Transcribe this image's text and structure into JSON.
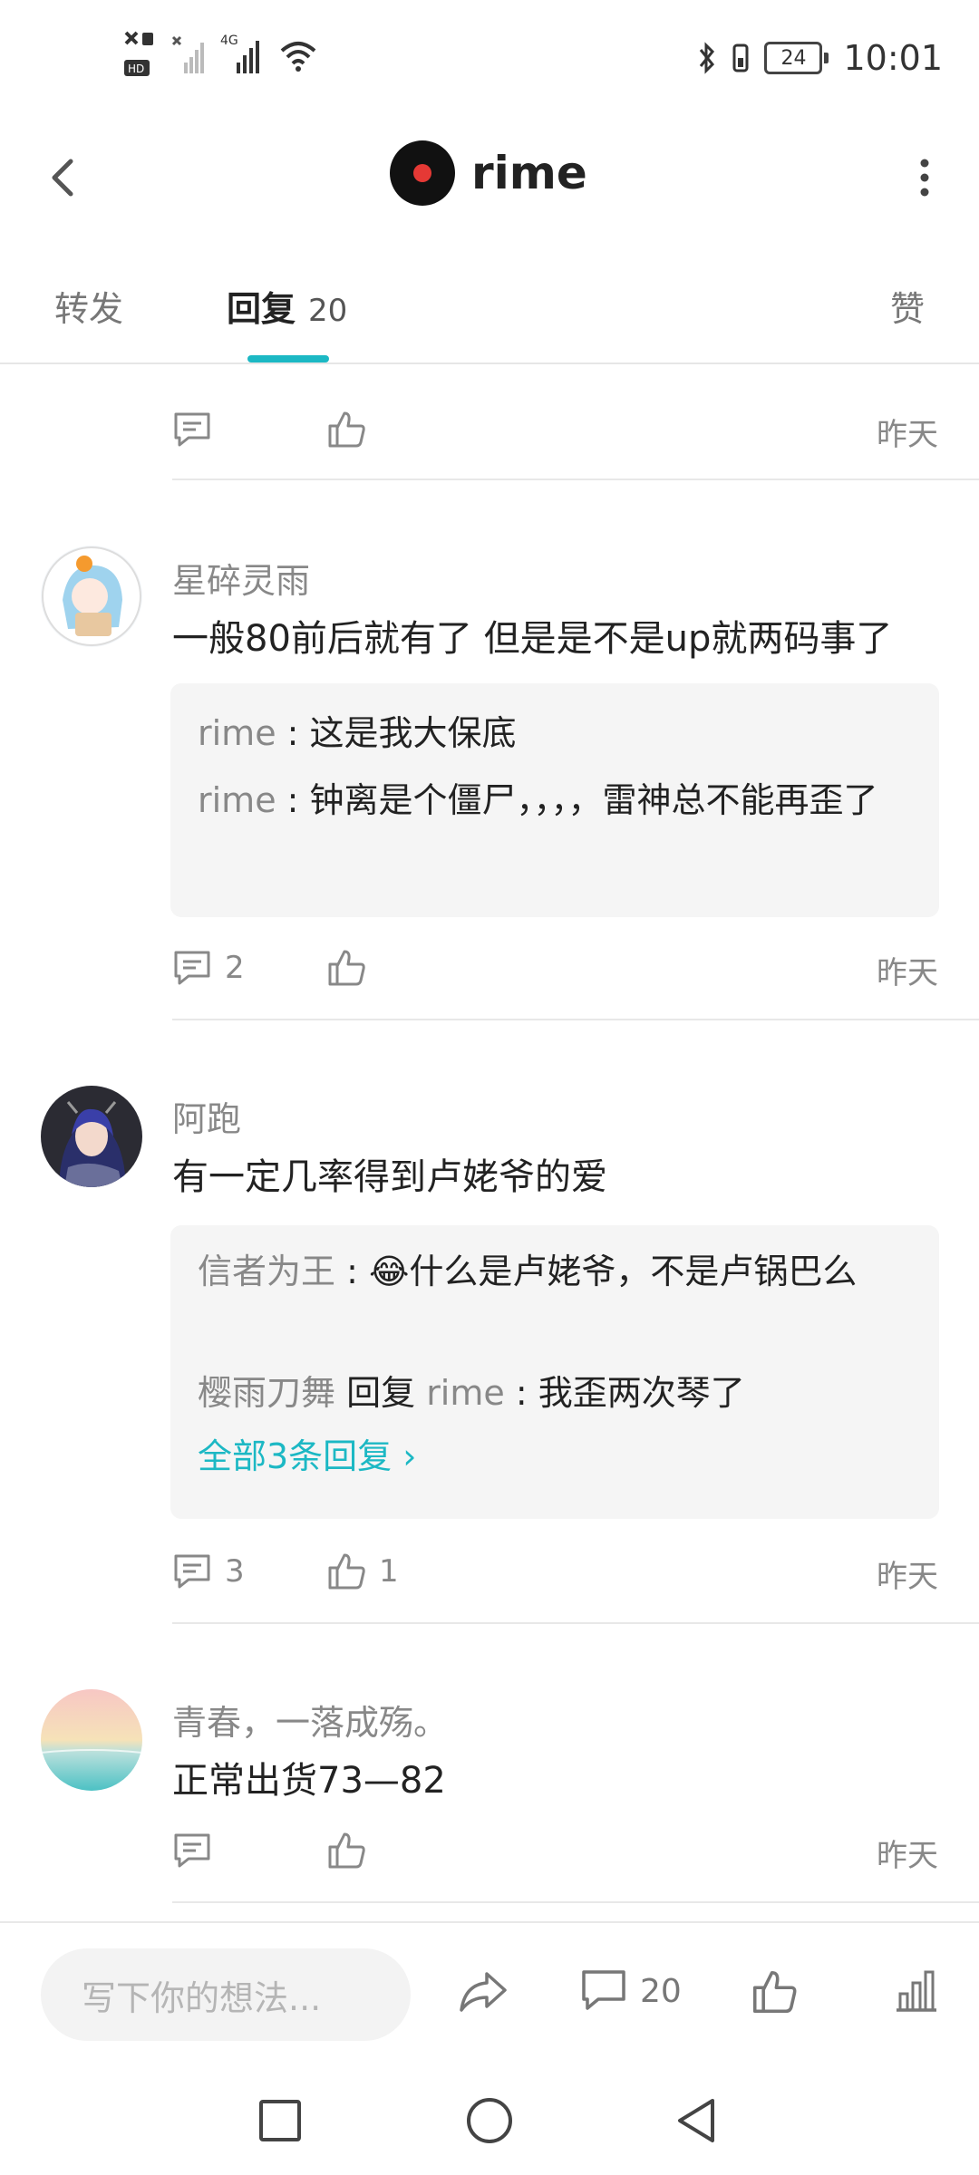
{
  "status_bar": {
    "time": "10:01",
    "battery": "24",
    "network": "4G"
  },
  "header": {
    "title": "rime"
  },
  "tabs": {
    "forward": "转发",
    "reply": "回复",
    "reply_count": "20",
    "like": "赞"
  },
  "first_item": {
    "date": "昨天"
  },
  "comments": [
    {
      "user": "星碎灵雨",
      "text": "一般80前后就有了 但是是不是up就两码事了",
      "replies": [
        {
          "user": "rime",
          "sep": " : ",
          "text": "这是我大保底"
        },
        {
          "user": "rime",
          "sep": " : ",
          "text": "钟离是个僵尸，，，，雷神总不能再歪了"
        }
      ],
      "reply_count": "2",
      "like_count": "",
      "date": "昨天"
    },
    {
      "user": "阿跑",
      "text": "有一定几率得到卢姥爷的爱",
      "replies": [
        {
          "user": "信者为王",
          "sep": " : ",
          "emoji": "😂",
          "text": "什么是卢姥爷，不是卢锅巴么"
        },
        {
          "user": "樱雨刀舞",
          "mid": " 回复 ",
          "target": "rime",
          "sep": " : ",
          "text": "我歪两次琴了"
        }
      ],
      "more": "全部3条回复 ›",
      "reply_count": "3",
      "like_count": "1",
      "date": "昨天"
    },
    {
      "user": "青春，一落成殇。",
      "text": "正常出货73—82",
      "reply_count": "",
      "like_count": "",
      "date": "昨天"
    }
  ],
  "bottom_bar": {
    "placeholder": "写下你的想法...",
    "comment_count": "20"
  },
  "colors": {
    "accent": "#1cb8c4",
    "text": "#222222",
    "muted": "#888888",
    "subbox": "#f5f5f5"
  }
}
